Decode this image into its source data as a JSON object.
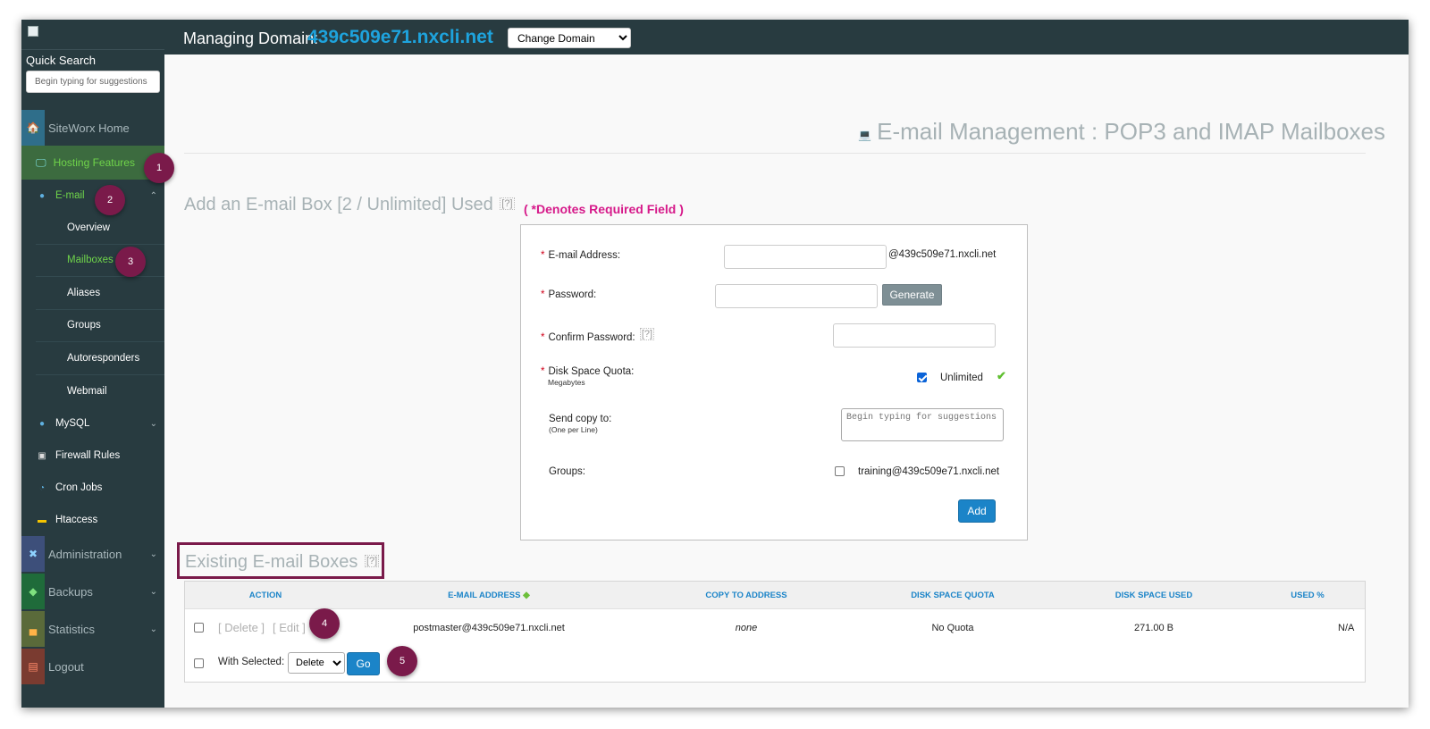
{
  "sidebar": {
    "quick_search_label": "Quick Search",
    "quick_search_placeholder": "Begin typing for suggestions",
    "items": {
      "siteworx_home": "SiteWorx Home",
      "hosting_features": "Hosting Features",
      "email": "E-mail",
      "overview": "Overview",
      "mailboxes": "Mailboxes",
      "aliases": "Aliases",
      "groups": "Groups",
      "autoresponders": "Autoresponders",
      "webmail": "Webmail",
      "mysql": "MySQL",
      "firewall_rules": "Firewall Rules",
      "cron_jobs": "Cron Jobs",
      "htaccess": "Htaccess",
      "administration": "Administration",
      "backups": "Backups",
      "statistics": "Statistics",
      "logout": "Logout"
    }
  },
  "header": {
    "managing_label": "Managing Domain:",
    "domain": "439c509e71.nxcli.net",
    "change_domain_option": "Change Domain"
  },
  "page": {
    "title": "E-mail Management : POP3 and IMAP Mailboxes",
    "add_title": "Add an E-mail Box [2 / Unlimited] Used",
    "help_mark": "[?]",
    "required_note": "( *Denotes Required Field )"
  },
  "form": {
    "email_label": "E-mail Address:",
    "email_suffix": "@439c509e71.nxcli.net",
    "password_label": "Password:",
    "generate_label": "Generate",
    "confirm_label": "Confirm Password:",
    "quota_label": "Disk Space Quota:",
    "quota_unit": "Megabytes",
    "unlimited_label": "Unlimited",
    "copy_label": "Send copy to:",
    "copy_sub": "(One per Line)",
    "copy_placeholder": "Begin typing for suggestions",
    "groups_label": "Groups:",
    "group_option": "training@439c509e71.nxcli.net",
    "add_label": "Add",
    "required_star": "*"
  },
  "existing": {
    "title": "Existing E-mail Boxes",
    "columns": [
      "ACTION",
      "E-MAIL ADDRESS",
      "COPY TO ADDRESS",
      "DISK SPACE QUOTA",
      "DISK SPACE USED",
      "USED %"
    ],
    "rows": [
      {
        "delete": "[ Delete ]",
        "edit": "[ Edit ]",
        "email": "postmaster@439c509e71.nxcli.net",
        "copy_to": "none",
        "quota": "No Quota",
        "used": "271.00 B",
        "used_pct": "N/A"
      }
    ],
    "with_selected_label": "With Selected:",
    "bulk_option": "Delete",
    "go_label": "Go"
  },
  "callouts": [
    "1",
    "2",
    "3",
    "4",
    "5"
  ],
  "colors": {
    "sidebar_bg": "#283b40",
    "accent_blue": "#1ea3dd",
    "active_green": "#6fd44a",
    "callout": "#7a1a4a",
    "required": "#d61a8a"
  }
}
